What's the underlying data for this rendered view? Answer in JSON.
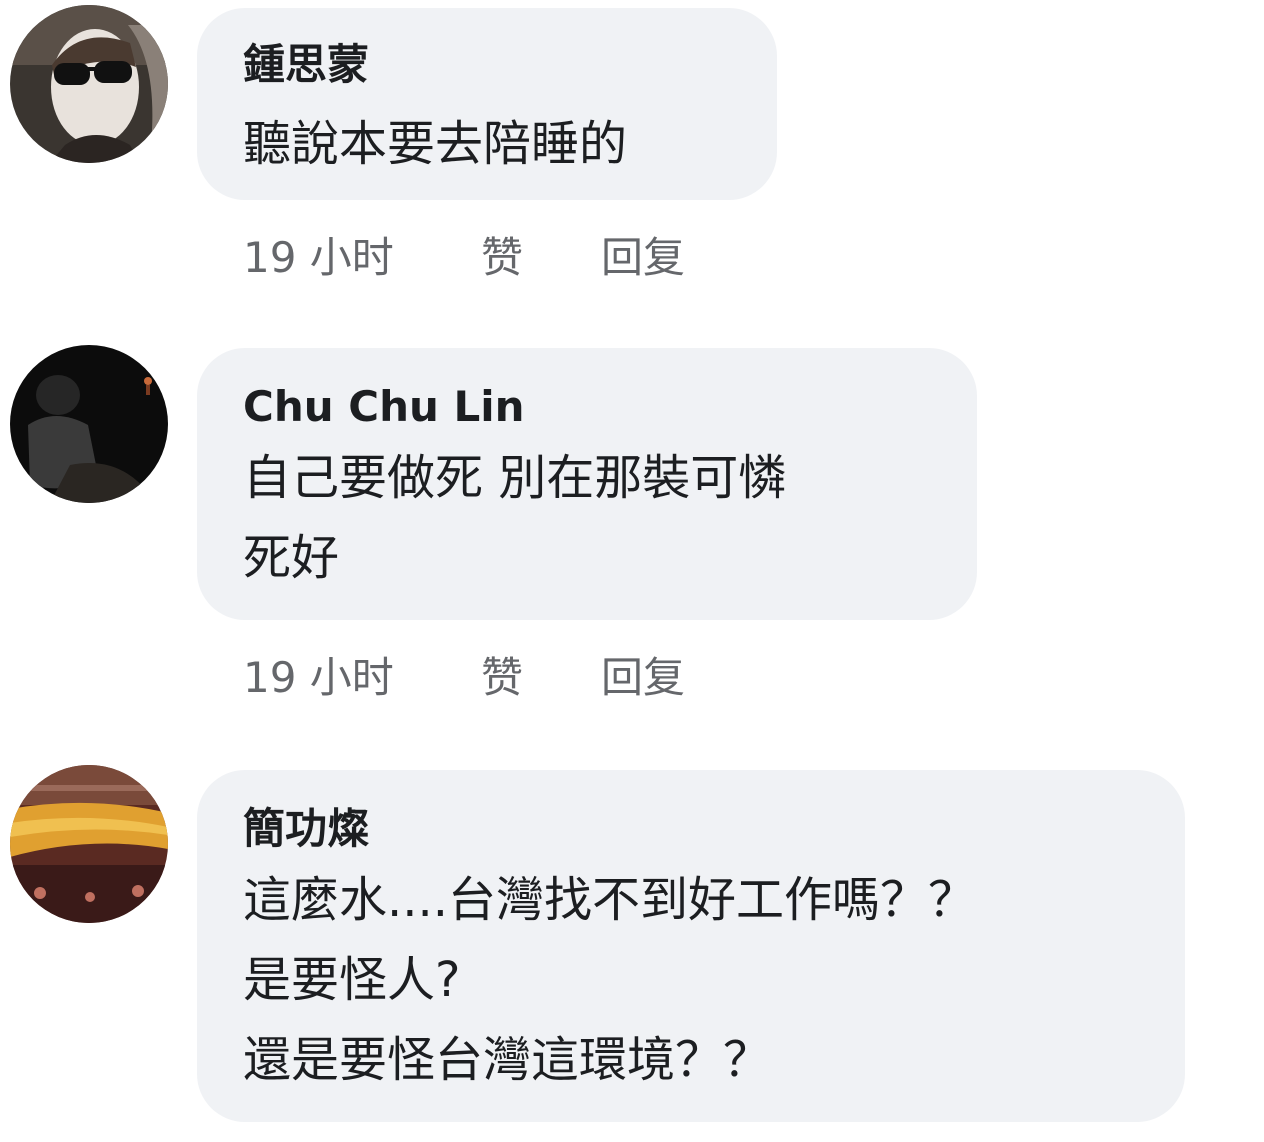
{
  "comments": [
    {
      "author": "鍾思蒙",
      "lines": [
        "聽說本要去陪睡的"
      ],
      "time": "19 小时",
      "like_label": "赞",
      "reply_label": "回复"
    },
    {
      "author": "Chu Chu Lin",
      "lines": [
        "自己要做死 別在那裝可憐",
        "死好"
      ],
      "time": "19 小时",
      "like_label": "赞",
      "reply_label": "回复"
    },
    {
      "author": "簡功燦",
      "lines": [
        "這麼水....台灣找不到好工作嗎？？",
        "是要怪人?",
        "還是要怪台灣這環境？？"
      ]
    }
  ],
  "colors": {
    "bubble_bg": "#f0f2f5",
    "author_text": "#1c1e21",
    "body_text": "#1c1e21",
    "meta_text": "#65676b"
  }
}
